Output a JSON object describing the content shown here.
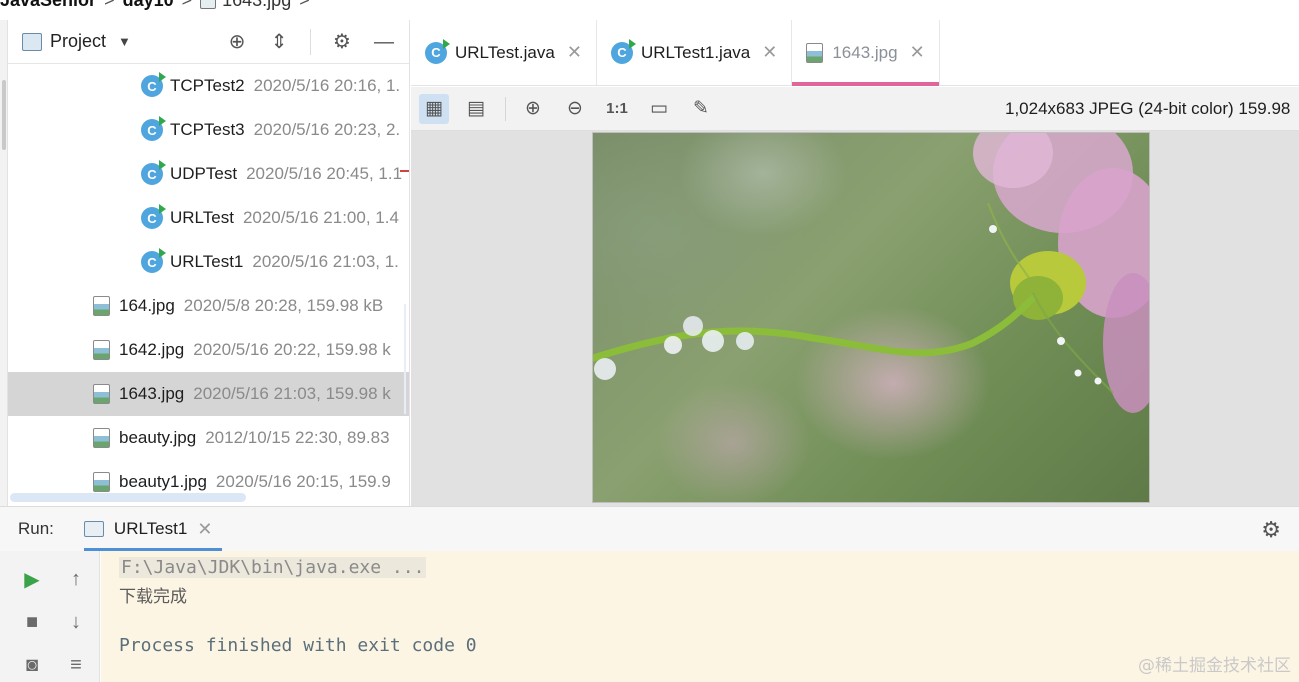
{
  "breadcrumb": {
    "items": [
      "JavaSenior",
      "day10",
      "1643.jpg"
    ]
  },
  "project": {
    "title": "Project",
    "tree": [
      {
        "name": "TCPTest2",
        "meta": "2020/5/16 20:16, 1.",
        "type": "java"
      },
      {
        "name": "TCPTest3",
        "meta": "2020/5/16 20:23, 2.",
        "type": "java"
      },
      {
        "name": "UDPTest",
        "meta": "2020/5/16 20:45, 1.1",
        "type": "java"
      },
      {
        "name": "URLTest",
        "meta": "2020/5/16 21:00, 1.4",
        "type": "java"
      },
      {
        "name": "URLTest1",
        "meta": "2020/5/16 21:03, 1.",
        "type": "java"
      },
      {
        "name": "164.jpg",
        "meta": "2020/5/8 20:28, 159.98 kB",
        "type": "image"
      },
      {
        "name": "1642.jpg",
        "meta": "2020/5/16 20:22, 159.98 k",
        "type": "image"
      },
      {
        "name": "1643.jpg",
        "meta": "2020/5/16 21:03, 159.98 k",
        "type": "image",
        "selected": true
      },
      {
        "name": "beauty.jpg",
        "meta": "2012/10/15 22:30, 89.83",
        "type": "image"
      },
      {
        "name": "beauty1.jpg",
        "meta": "2020/5/16 20:15, 159.9",
        "type": "image"
      }
    ]
  },
  "editor": {
    "tabs": [
      {
        "label": "URLTest.java",
        "type": "java"
      },
      {
        "label": "URLTest1.java",
        "type": "java"
      },
      {
        "label": "1643.jpg",
        "type": "image",
        "active": true
      }
    ],
    "image_info": "1,024x683 JPEG (24-bit color) 159.98",
    "zoom_actual_label": "1:1"
  },
  "run": {
    "label": "Run:",
    "tab_label": "URLTest1",
    "console": {
      "command": "F:\\Java\\JDK\\bin\\java.exe ...",
      "output": "下载完成",
      "exit": "Process finished with exit code 0"
    }
  },
  "watermark": "@稀土掘金技术社区",
  "icons": {
    "run": "play-icon",
    "stop": "stop-icon",
    "settings": "gear-icon"
  },
  "colors": {
    "active_tab_underline": "#e0659a",
    "run_tab_underline": "#4f8fd8",
    "console_bg": "#fdf5e4",
    "java_icon": "#4fa6de"
  }
}
